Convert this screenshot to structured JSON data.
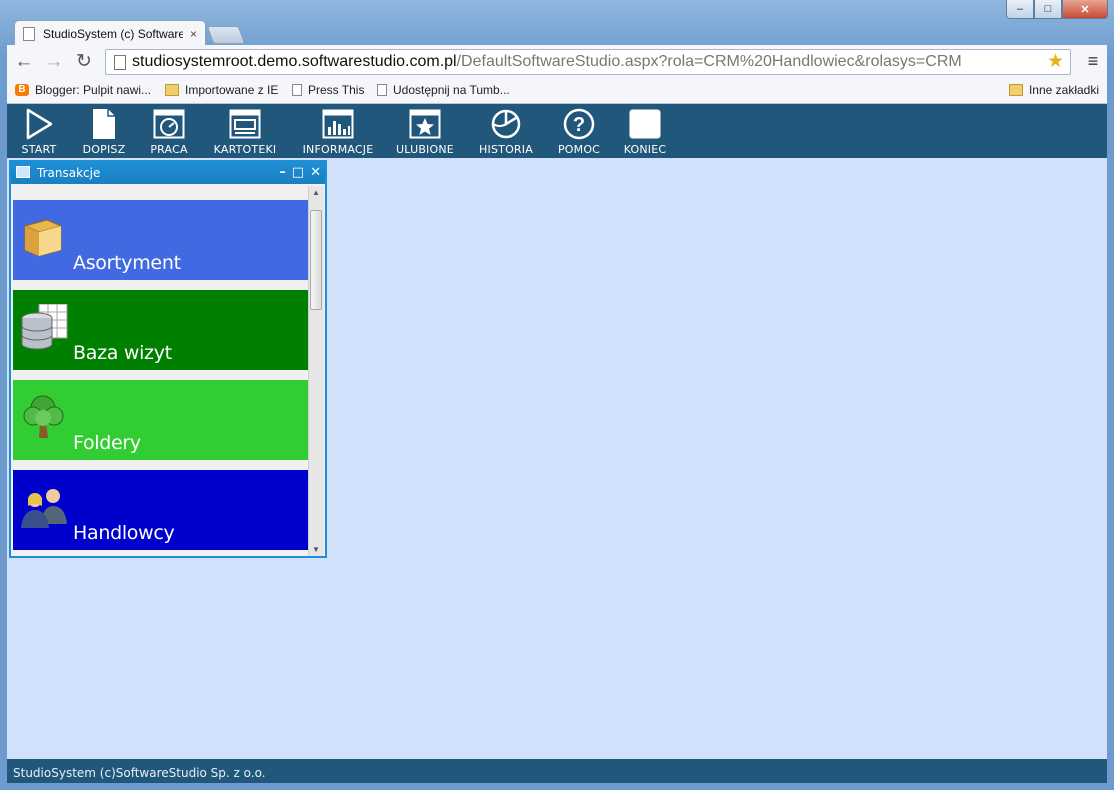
{
  "browser": {
    "tab_title": "StudioSystem (c) Software",
    "tab_close": "×",
    "url_host": "studiosystemroot.demo.softwarestudio.com.pl",
    "url_rest": "/DefaultSoftwareStudio.aspx?rola=CRM%20Handlowiec&rolasys=CRM",
    "back": "←",
    "forward": "→",
    "reload": "↻",
    "star": "★",
    "menu": "≡",
    "window_controls": {
      "minimize": "–",
      "maximize": "□",
      "close": "✕"
    },
    "bookmarks": [
      {
        "label": "Blogger: Pulpit nawi...",
        "icon": "blogger-icon"
      },
      {
        "label": "Importowane z IE",
        "icon": "folder-icon"
      },
      {
        "label": "Press This",
        "icon": "page-icon"
      },
      {
        "label": "Udostępnij na Tumb...",
        "icon": "page-icon"
      }
    ],
    "other_bookmarks": "Inne zakładki"
  },
  "app": {
    "toolbar": [
      {
        "label": "START",
        "icon": "play-icon"
      },
      {
        "label": "DOPISZ",
        "icon": "new-document-icon"
      },
      {
        "label": "PRACA",
        "icon": "gauge-icon"
      },
      {
        "label": "KARTOTEKI",
        "icon": "monitor-icon"
      },
      {
        "label": "INFORMACJE",
        "icon": "bar-chart-icon"
      },
      {
        "label": "ULUBIONE",
        "icon": "star-icon"
      },
      {
        "label": "HISTORIA",
        "icon": "history-icon"
      },
      {
        "label": "POMOC",
        "icon": "help-icon"
      },
      {
        "label": "KONIEC",
        "icon": "exit-icon"
      }
    ],
    "panel": {
      "title": "Transakcje",
      "controls": {
        "minimize": "–",
        "maximize": "□",
        "close": "✕"
      },
      "tiles": [
        {
          "label": "Asortyment",
          "color": "#4169e1",
          "icon": "box-icon"
        },
        {
          "label": "Baza wizyt",
          "color": "#008000",
          "icon": "database-icon"
        },
        {
          "label": "Foldery",
          "color": "#32cd32",
          "icon": "tree-icon"
        },
        {
          "label": "Handlowcy",
          "color": "#0000cd",
          "icon": "users-icon"
        }
      ]
    },
    "footer": "StudioSystem (c)SoftwareStudio Sp. z o.o."
  }
}
